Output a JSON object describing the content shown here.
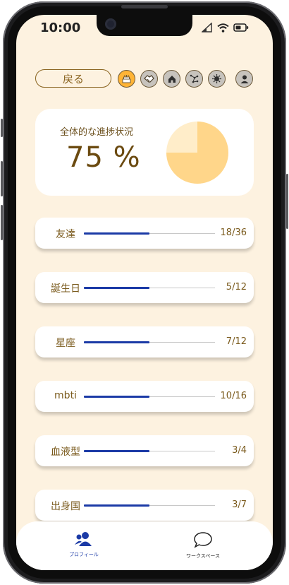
{
  "status_bar": {
    "time": "10:00"
  },
  "toolbar": {
    "back_label": "戻る",
    "icons": [
      "cake-icon",
      "handshake-icon",
      "home-icon",
      "constellation-icon",
      "virus-icon",
      "user-icon"
    ]
  },
  "summary": {
    "title": "全体的な進捗状況",
    "percent_text": "75 %",
    "progress": 0.75,
    "colors": {
      "done": "#ffd68a",
      "remaining": "#ffedc9"
    }
  },
  "categories": [
    {
      "label": "友達",
      "count": "18/36",
      "fill": 0.5
    },
    {
      "label": "誕生日",
      "count": "5/12",
      "fill": 0.5
    },
    {
      "label": "星座",
      "count": "7/12",
      "fill": 0.5
    },
    {
      "label": "mbti",
      "count": "10/16",
      "fill": 0.5
    },
    {
      "label": "血液型",
      "count": "3/4",
      "fill": 0.5
    },
    {
      "label": "出身国",
      "count": "3/7",
      "fill": 0.5
    }
  ],
  "tab_bar": {
    "profile_label": "プロフィール",
    "workspace_label": "ワークスペース",
    "active_color": "#1b3aa6"
  }
}
